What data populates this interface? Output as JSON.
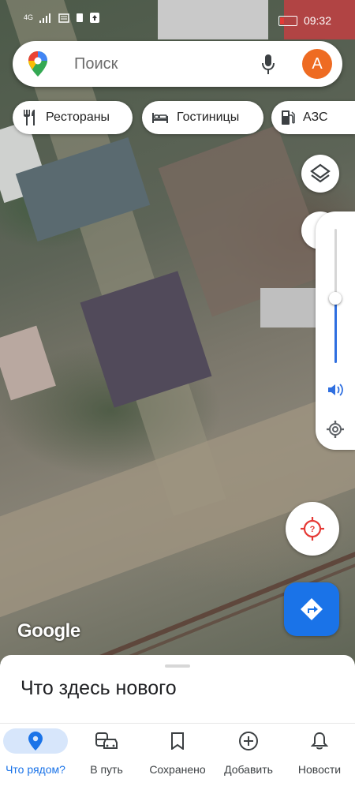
{
  "status_bar": {
    "network": "4G",
    "time": "09:32"
  },
  "search": {
    "placeholder": "Поиск",
    "avatar_letter": "A"
  },
  "chips": [
    {
      "label": "Рестораны",
      "icon": "fork-knife-icon"
    },
    {
      "label": "Гостиницы",
      "icon": "bed-icon"
    },
    {
      "label": "АЗС",
      "icon": "gas-station-icon"
    }
  ],
  "map": {
    "attribution": "Google",
    "volume_level": 0.48
  },
  "sheet": {
    "title": "Что здесь нового"
  },
  "nav": [
    {
      "label": "Что рядом?",
      "icon": "location-pin-icon",
      "active": true
    },
    {
      "label": "В путь",
      "icon": "commute-icon"
    },
    {
      "label": "Сохранено",
      "icon": "bookmark-icon"
    },
    {
      "label": "Добавить",
      "icon": "add-circle-icon"
    },
    {
      "label": "Новости",
      "icon": "bell-icon"
    }
  ],
  "colors": {
    "accent": "#1a73e8",
    "avatar": "#ee6b22",
    "locate": "#e53935"
  }
}
